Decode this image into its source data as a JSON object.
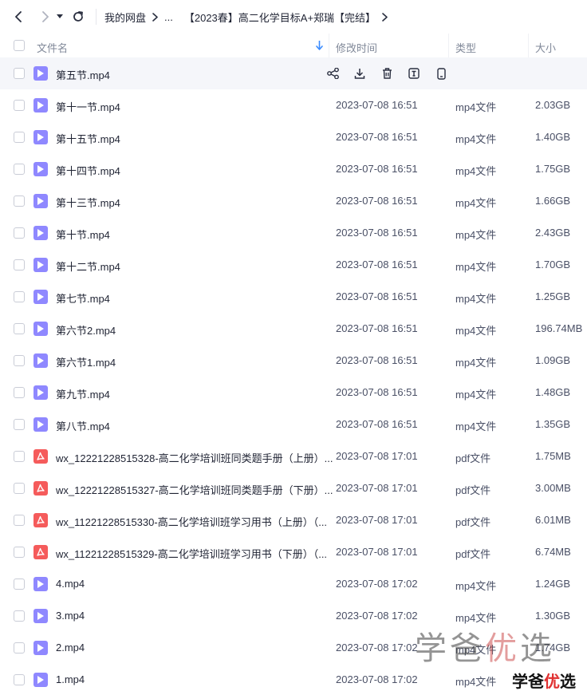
{
  "breadcrumb": {
    "root": "我的网盘",
    "ellipsis": "...",
    "current": "【2023春】高二化学目标A+郑瑞【完结】"
  },
  "columns": {
    "name": "文件名",
    "modified": "修改时间",
    "type": "类型",
    "size": "大小"
  },
  "hover_row": {
    "name": "第五节.mp4",
    "kind": "video"
  },
  "files": [
    {
      "name": "第十一节.mp4",
      "kind": "video",
      "modified": "2023-07-08 16:51",
      "type": "mp4文件",
      "size": "2.03GB"
    },
    {
      "name": "第十五节.mp4",
      "kind": "video",
      "modified": "2023-07-08 16:51",
      "type": "mp4文件",
      "size": "1.40GB"
    },
    {
      "name": "第十四节.mp4",
      "kind": "video",
      "modified": "2023-07-08 16:51",
      "type": "mp4文件",
      "size": "1.75GB"
    },
    {
      "name": "第十三节.mp4",
      "kind": "video",
      "modified": "2023-07-08 16:51",
      "type": "mp4文件",
      "size": "1.66GB"
    },
    {
      "name": "第十节.mp4",
      "kind": "video",
      "modified": "2023-07-08 16:51",
      "type": "mp4文件",
      "size": "2.43GB"
    },
    {
      "name": "第十二节.mp4",
      "kind": "video",
      "modified": "2023-07-08 16:51",
      "type": "mp4文件",
      "size": "1.70GB"
    },
    {
      "name": "第七节.mp4",
      "kind": "video",
      "modified": "2023-07-08 16:51",
      "type": "mp4文件",
      "size": "1.25GB"
    },
    {
      "name": "第六节2.mp4",
      "kind": "video",
      "modified": "2023-07-08 16:51",
      "type": "mp4文件",
      "size": "196.74MB"
    },
    {
      "name": "第六节1.mp4",
      "kind": "video",
      "modified": "2023-07-08 16:51",
      "type": "mp4文件",
      "size": "1.09GB"
    },
    {
      "name": "第九节.mp4",
      "kind": "video",
      "modified": "2023-07-08 16:51",
      "type": "mp4文件",
      "size": "1.48GB"
    },
    {
      "name": "第八节.mp4",
      "kind": "video",
      "modified": "2023-07-08 16:51",
      "type": "mp4文件",
      "size": "1.35GB"
    },
    {
      "name": "wx_12221228515328-高二化学培训班同类题手册（上册）...",
      "kind": "pdf",
      "modified": "2023-07-08 17:01",
      "type": "pdf文件",
      "size": "1.75MB"
    },
    {
      "name": "wx_12221228515327-高二化学培训班同类题手册（下册）...",
      "kind": "pdf",
      "modified": "2023-07-08 17:01",
      "type": "pdf文件",
      "size": "3.00MB"
    },
    {
      "name": "wx_11221228515330-高二化学培训班学习用书（上册）（...",
      "kind": "pdf",
      "modified": "2023-07-08 17:01",
      "type": "pdf文件",
      "size": "6.01MB"
    },
    {
      "name": "wx_11221228515329-高二化学培训班学习用书（下册）（...",
      "kind": "pdf",
      "modified": "2023-07-08 17:01",
      "type": "pdf文件",
      "size": "6.74MB"
    },
    {
      "name": "4.mp4",
      "kind": "video",
      "modified": "2023-07-08 17:02",
      "type": "mp4文件",
      "size": "1.24GB"
    },
    {
      "name": "3.mp4",
      "kind": "video",
      "modified": "2023-07-08 17:02",
      "type": "mp4文件",
      "size": "1.30GB"
    },
    {
      "name": "2.mp4",
      "kind": "video",
      "modified": "2023-07-08 17:02",
      "type": "mp4文件",
      "size": "1.74GB"
    },
    {
      "name": "1.mp4",
      "kind": "video",
      "modified": "2023-07-08 17:02",
      "type": "mp4文件",
      "size": ""
    }
  ],
  "watermark": {
    "large_text_a": "学爸",
    "large_text_b": "优",
    "large_text_c": "选",
    "small_text_a": "学爸",
    "small_text_b": "优",
    "small_text_c": "选"
  },
  "colors": {
    "video_icon": "#8f88ff",
    "pdf_icon": "#f55b5b",
    "sort_arrow": "#3b8cff"
  }
}
